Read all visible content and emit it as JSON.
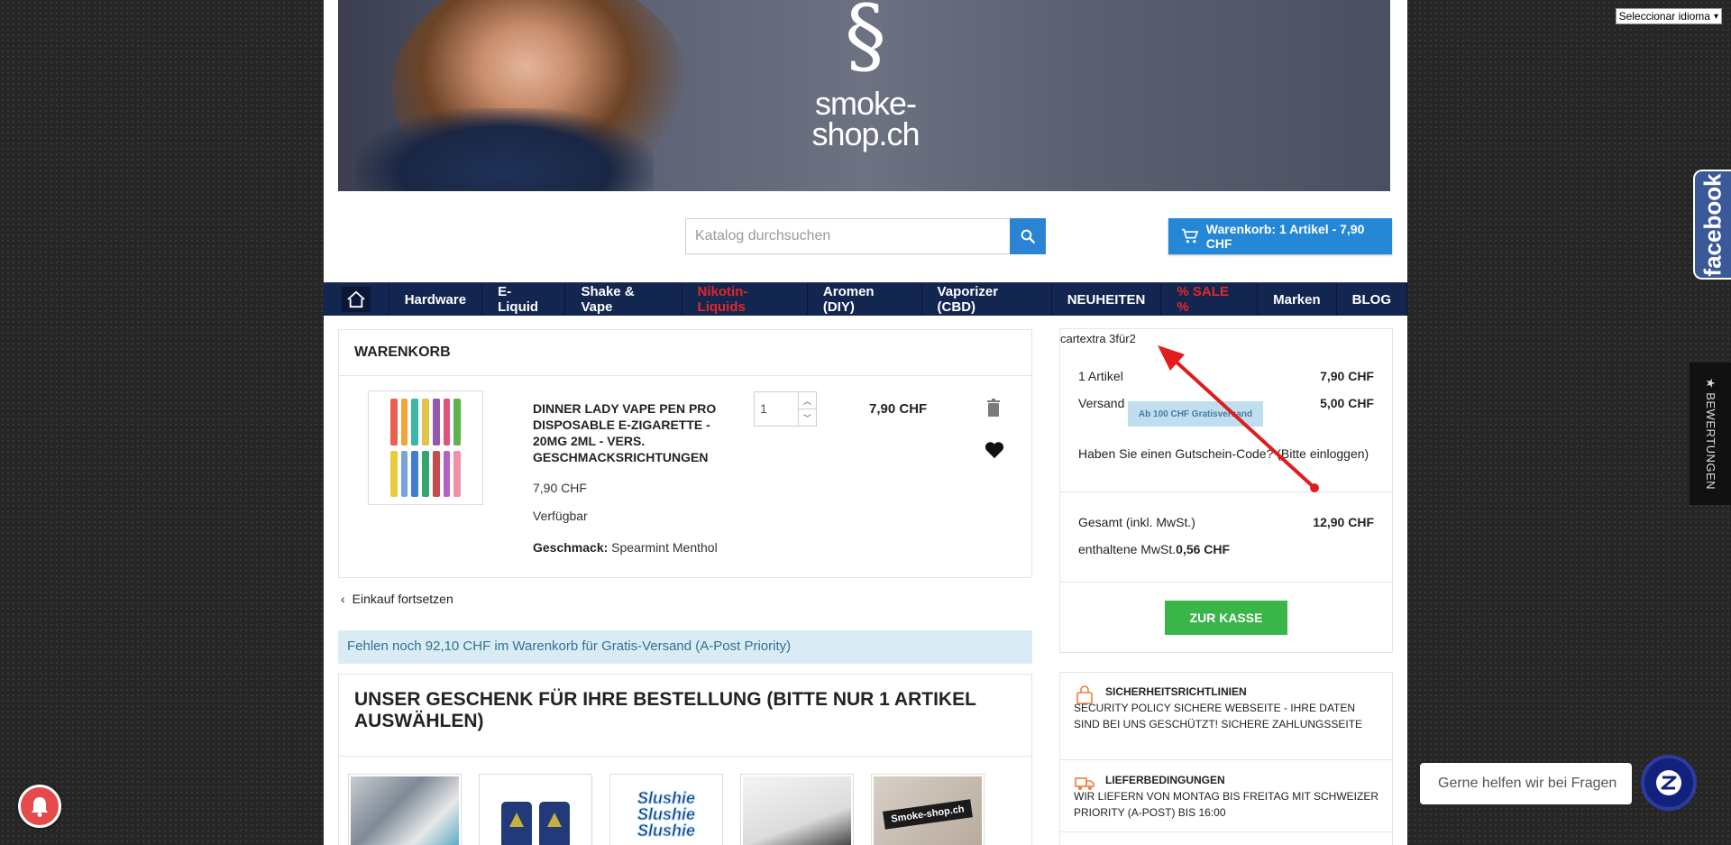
{
  "language_select": {
    "label": "Seleccionar idioma"
  },
  "header": {
    "logo_line1": "smoke-",
    "logo_line2": "shop.ch",
    "search_placeholder": "Katalog durchsuchen",
    "cart_button": "Warenkorb: 1 Artikel - 7,90 CHF"
  },
  "nav": {
    "items": [
      {
        "label": "Hardware"
      },
      {
        "label": "E-Liquid"
      },
      {
        "label": "Shake & Vape"
      },
      {
        "label": "Nikotin-Liquids",
        "highlight": "#e4262a"
      },
      {
        "label": "Aromen (DIY)"
      },
      {
        "label": "Vaporizer (CBD)"
      },
      {
        "label": "NEUHEITEN"
      },
      {
        "label": "% SALE %",
        "highlight": "#e4262a"
      },
      {
        "label": "Marken"
      },
      {
        "label": "BLOG"
      }
    ]
  },
  "cart": {
    "title": "WARENKORB",
    "product": {
      "name": "DINNER LADY VAPE PEN PRO DISPOSABLE E-ZIGARETTE - 20MG 2ML - VERS. GESCHMACKSRICHTUNGEN",
      "price": "7,90 CHF",
      "availability": "Verfügbar",
      "attr_label": "Geschmack:",
      "attr_value": "Spearmint Menthol",
      "quantity": "1",
      "line_total": "7,90 CHF"
    },
    "continue_label": "Einkauf fortsetzen",
    "free_shipping_notice": "Fehlen noch 92,10 CHF im Warenkorb für Gratis-Versand (A-Post Priority)"
  },
  "gift": {
    "title": "UNSER GESCHENK FÜR IHRE BESTELLUNG (BITTE NUR 1 ARTIKEL AUSWÄHLEN)",
    "keychain_text": "Smoke-shop.ch",
    "sticker_text": "Slushie"
  },
  "summary": {
    "cartextra": "cartextra 3für2",
    "items_label": "1 Artikel",
    "items_value": "7,90 CHF",
    "shipping_label": "Versand",
    "shipping_value": "5,00 CHF",
    "shipping_badge": "Ab 100 CHF Gratisversand",
    "voucher_text": "Haben Sie einen Gutschein-Code? (Bitte einloggen)",
    "total_label": "Gesamt (inkl. MwSt.)",
    "total_value": "12,90 CHF",
    "tax_label": "enthaltene MwSt.",
    "tax_value": "0,56 CHF",
    "checkout_label": "ZUR KASSE"
  },
  "reassurance": [
    {
      "title": "SICHERHEITSRICHTLINIEN",
      "text": "SECURITY POLICY SICHERE WEBSEITE - IHRE DATEN SIND BEI UNS GESCHÜTZT! SICHERE ZAHLUNGSSEITE",
      "icon": "lock-icon"
    },
    {
      "title": "LIEFERBEDINGUNGEN",
      "text": "WIR LIEFERN VON MONTAG BIS FREITAG MIT SCHWEIZER PRIORITY (A-POST) BIS 16:00",
      "icon": "truck-icon"
    }
  ],
  "widgets": {
    "facebook_label": "facebook",
    "reviews_label": "★ BEWERTUNGEN",
    "chat_text": "Gerne helfen wir bei Fragen"
  },
  "colors": {
    "nav_bg": "#13264f",
    "accent_blue": "#2588d6",
    "checkout_green": "#3ab54a",
    "sale_red": "#e4262a",
    "notice_bg": "#d9ecf6"
  }
}
